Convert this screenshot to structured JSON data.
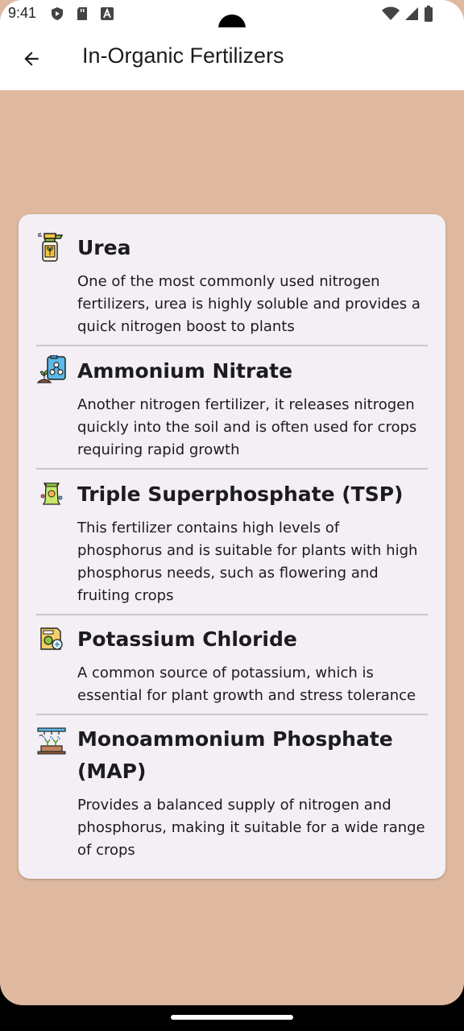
{
  "status_bar": {
    "time": "9:41"
  },
  "appbar": {
    "title": "In-Organic Fertilizers"
  },
  "fertilizers": [
    {
      "title": "Urea",
      "description": "One of the most commonly used nitrogen fertilizers, urea is highly soluble and provides a quick nitrogen boost to plants",
      "icon": "spray-bottle-icon"
    },
    {
      "title": "Ammonium Nitrate",
      "description": "Another nitrogen fertilizer, it releases nitrogen quickly into the soil and is often used for crops requiring rapid growth",
      "icon": "chemical-plant-icon"
    },
    {
      "title": "Triple Superphosphate (TSP)",
      "description": "This fertilizer contains high levels of phosphorus and is suitable for plants with high phosphorus needs, such as flowering and fruiting crops",
      "icon": "fertilizer-bag-icon"
    },
    {
      "title": "Potassium Chloride",
      "description": "A common source of potassium, which is essential for plant growth and stress tolerance",
      "icon": "seed-packet-icon"
    },
    {
      "title": "Monoammonium Phosphate (MAP)",
      "description": "Provides a balanced supply of nitrogen and phosphorus, making it suitable for a wide range of crops",
      "icon": "irrigation-icon"
    }
  ]
}
